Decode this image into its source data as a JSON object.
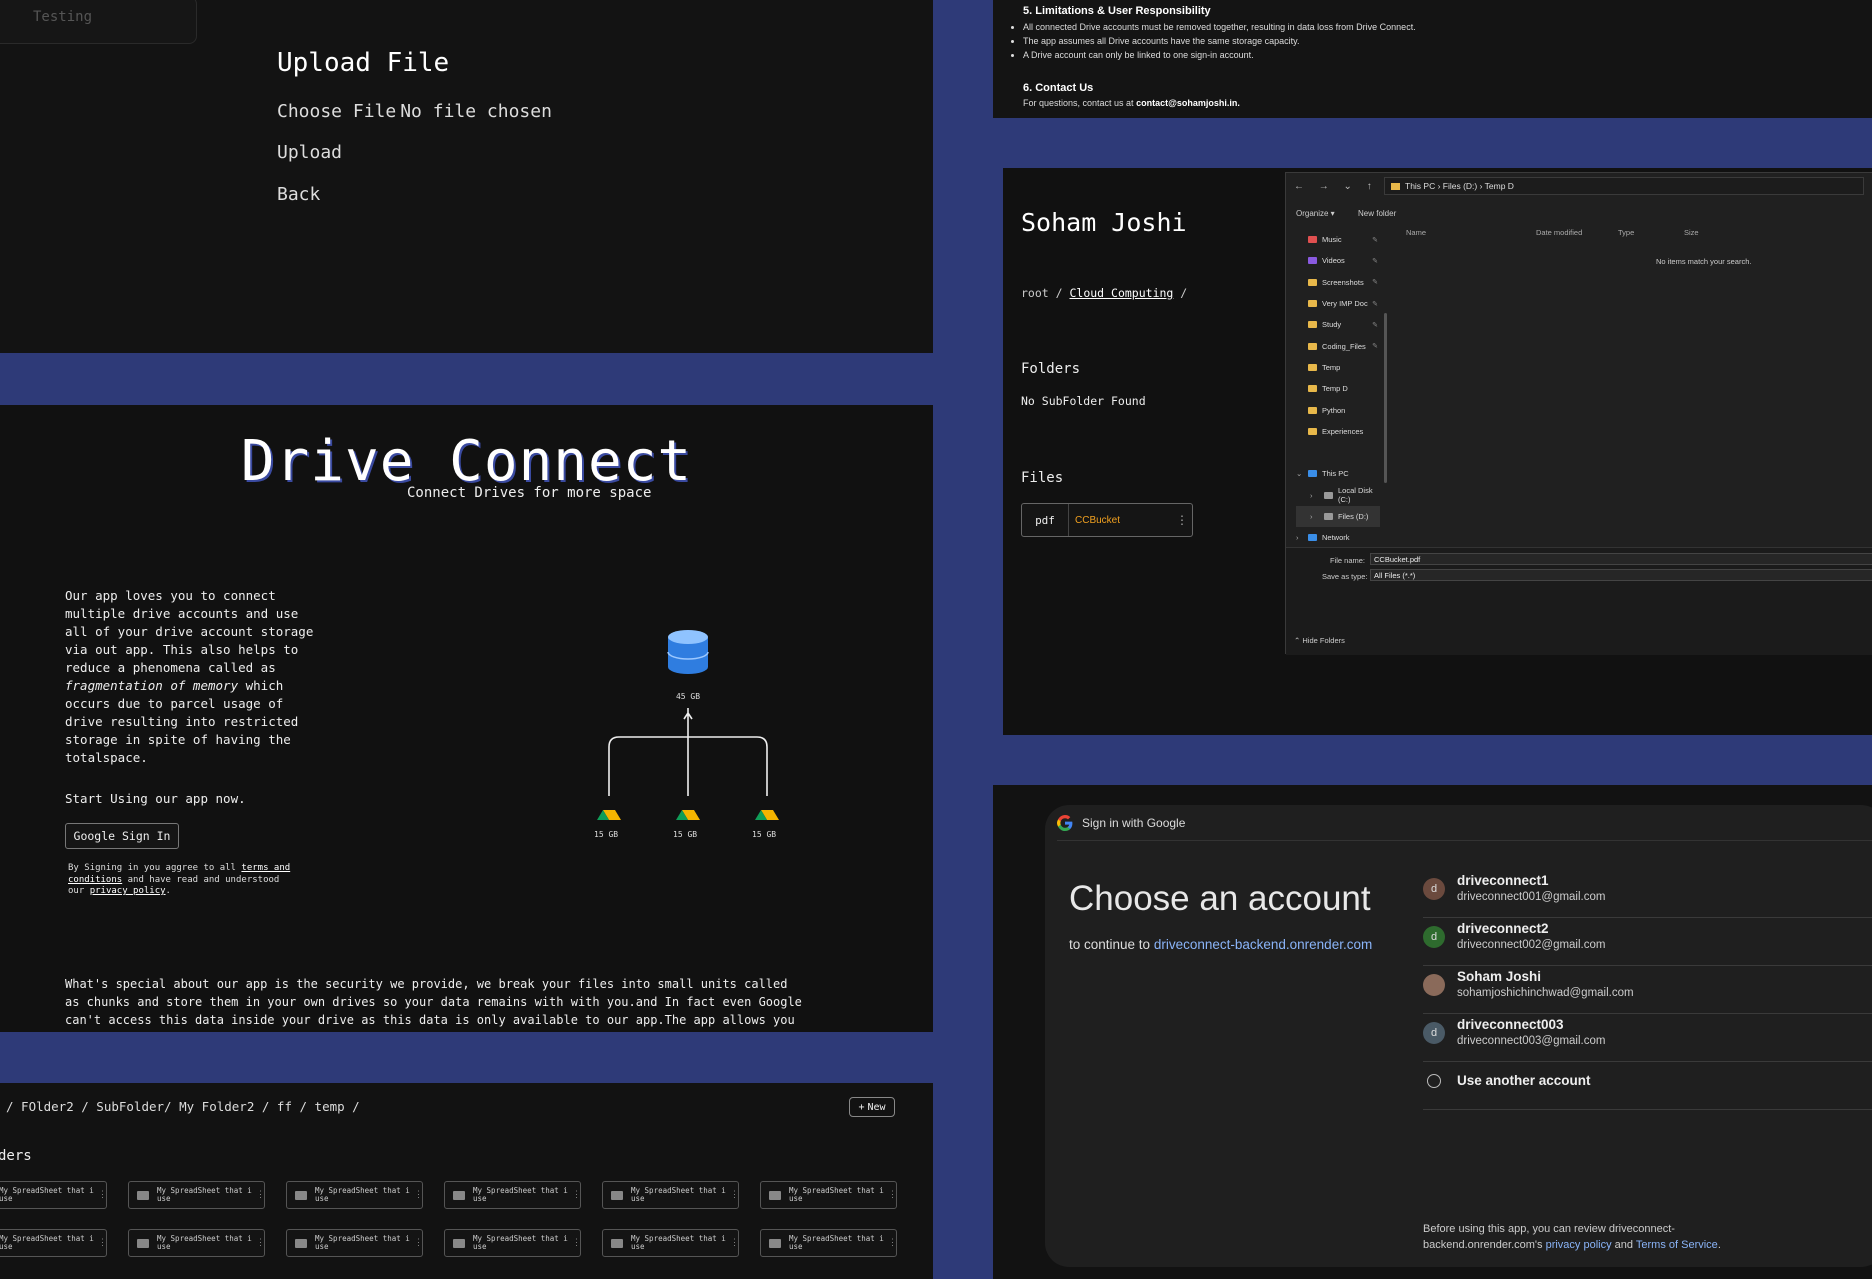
{
  "upload": {
    "tab_label": "Testing",
    "title": "Upload File",
    "choose_file": "Choose File",
    "no_file": "No file chosen",
    "upload": "Upload",
    "back": "Back"
  },
  "drive": {
    "brand": "Drive Connect",
    "tagline": "Connect Drives for more space",
    "desc_part1": "Our app loves you to connect multiple drive accounts and use all of your drive account storage via out app. This also helps to reduce a phenomena called as",
    "desc_italic": "fragmentation of memory",
    "desc_part2": "which occurs due to parcel usage of drive resulting into restricted storage in spite of having the totalspace.",
    "start": "Start Using our app now.",
    "signin_button": "Google Sign In",
    "terms_part1": "By Signing in you aggree to all",
    "terms_link1": "terms and conditions",
    "terms_part2": "and have read and understood our",
    "terms_link2": "privacy policy",
    "terms_end": ".",
    "special": "What's special about our app is the security we provide, we break your files into small units called as chunks and store them in your own drives so your data remains with with you.and In fact even Google can't access this data inside your drive as this data is only available to our app.The app allows you to have",
    "total_label": "45 GB",
    "drive_labels": [
      "15 GB",
      "15 GB",
      "15 GB"
    ]
  },
  "list": {
    "breadcrumb": "/ FOlder2 / SubFolder/ My Folder2 / ff / temp /",
    "new_button": "New",
    "section": "ders",
    "tile_name": "My SpreadSheet that i use"
  },
  "terms": {
    "h5": "5. Limitations & User Responsibility",
    "bullets": [
      "All connected Drive accounts must be removed together, resulting in data loss from Drive Connect.",
      "The app assumes all Drive accounts have the same storage capacity.",
      "A Drive account can only be linked to one sign-in account."
    ],
    "h6": "6. Contact Us",
    "contact_text": "For questions, contact us at",
    "contact_email": "contact@sohamjoshi.in."
  },
  "soham": {
    "name": "Soham Joshi",
    "path_root": "root /",
    "path_current": "Cloud Computing",
    "path_end": "/",
    "folders": "Folders",
    "no_sub": "No SubFolder Found",
    "files": "Files",
    "file_ext": "pdf",
    "file_name": "CCBucket",
    "explorer": {
      "address": "This PC  ›  Files (D:)  ›  Temp D",
      "organize": "Organize ▾",
      "new_folder": "New folder",
      "sidebar": [
        "Music",
        "Videos",
        "Screenshots",
        "Very IMP Doc",
        "Study",
        "Coding_Files",
        "Temp",
        "Temp D",
        "Python",
        "Experiences",
        "",
        "This PC",
        "Local Disk (C:)",
        "Files (D:)",
        "Network"
      ],
      "col_name": "Name",
      "col_date": "Date modified",
      "col_type": "Type",
      "col_size": "Size",
      "empty": "No items match your search.",
      "file_name_label": "File name:",
      "file_name_value": "CCBucket.pdf",
      "save_type_label": "Save as type:",
      "save_type_value": "All Files (*.*)",
      "hide_folders": "Hide Folders"
    }
  },
  "google": {
    "header": "Sign in with Google",
    "title": "Choose an account",
    "continue_text": "to continue to",
    "continue_link": "driveconnect-backend.onrender.com",
    "accounts": [
      {
        "initial": "d",
        "name": "driveconnect1",
        "email": "driveconnect001@gmail.com",
        "color": "#6b4a3e"
      },
      {
        "initial": "d",
        "name": "driveconnect2",
        "email": "driveconnect002@gmail.com",
        "color": "#2e6b2e"
      },
      {
        "initial": "",
        "name": "Soham Joshi",
        "email": "sohamjoshichinchwad@gmail.com",
        "color": "#8a6a5a"
      },
      {
        "initial": "d",
        "name": "driveconnect003",
        "email": "driveconnect003@gmail.com",
        "color": "#4a5a66"
      }
    ],
    "another": "Use another account",
    "review_text": "Before using this app, you can review driveconnect-backend.onrender.com's",
    "privacy": "privacy policy",
    "and": "and",
    "tos": "Terms of Service",
    "period": "."
  }
}
